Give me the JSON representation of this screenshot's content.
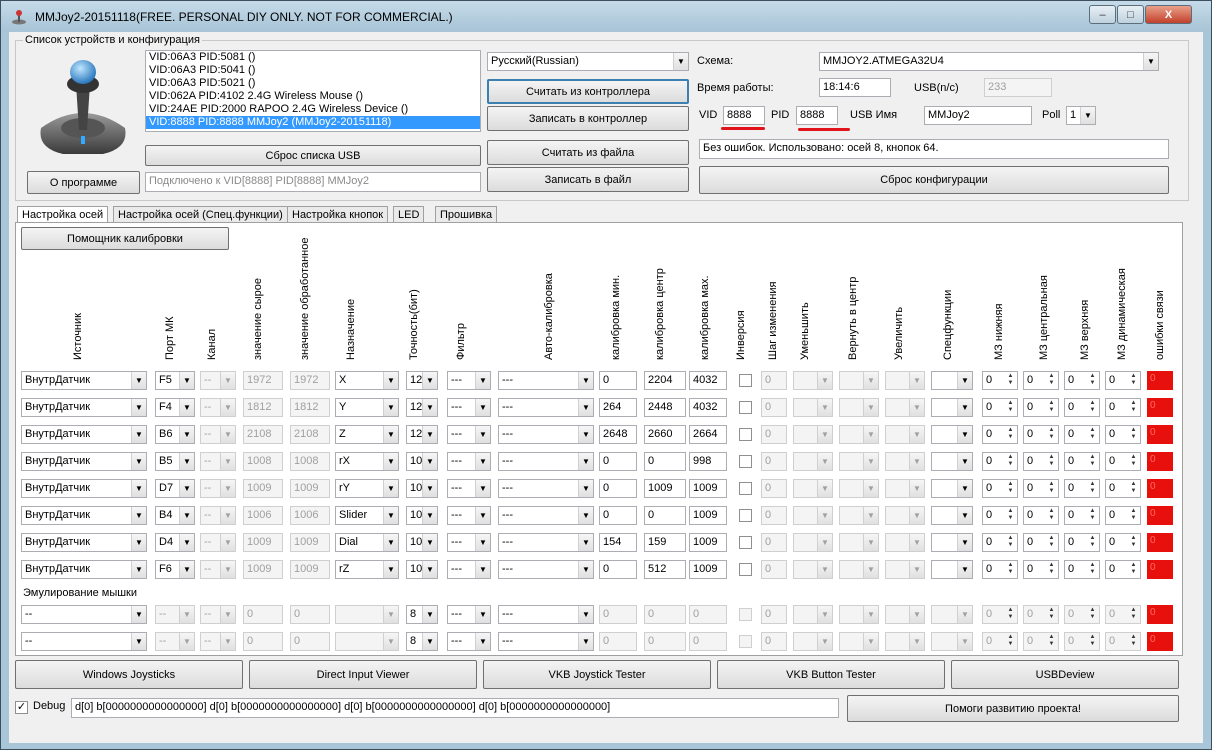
{
  "window": {
    "title": "MMJoy2-20151118(FREE. PERSONAL DIY ONLY. NOT FOR COMMERCIAL.)",
    "min": "–",
    "max": "□",
    "close": "X"
  },
  "devices": {
    "group_label": "Список устройств и конфигурация",
    "list": [
      "VID:06A3 PID:5081  ()",
      "VID:06A3 PID:5041  ()",
      "VID:06A3 PID:5021  ()",
      "VID:062A PID:4102 2.4G Wireless Mouse ()",
      "VID:24AE PID:2000 RAPOO 2.4G Wireless Device ()",
      "VID:8888 PID:8888 MMJoy2 (MMJoy2-20151118)"
    ],
    "reset_usb": "Сброс списка USB",
    "about": "О программе",
    "connected": "Подключено к VID[8888] PID[8888] MMJoy2"
  },
  "controller": {
    "language": "Русский(Russian)",
    "read_controller": "Считать из контроллера",
    "write_controller": "Записать в контроллер",
    "read_file": "Считать из файла",
    "write_file": "Записать в файл"
  },
  "config": {
    "scheme_label": "Схема:",
    "scheme_value": "MMJOY2.ATMEGA32U4",
    "uptime_label": "Время работы:",
    "uptime_value": "18:14:6",
    "usb_nc_label": "USB(n/c)",
    "usb_nc_value": "233",
    "vid_label": "VID",
    "vid_value": "8888",
    "pid_label": "PID",
    "pid_value": "8888",
    "usbname_label": "USB Имя",
    "usbname_value": "MMJoy2",
    "poll_label": "Poll",
    "poll_value": "1",
    "status": "Без ошибок. Использовано: осей  8, кнопок  64.",
    "reset_config": "Сброс конфигурации"
  },
  "tabs": [
    "Настройка осей",
    "Настройка осей (Спец.функции)",
    "Настройка кнопок",
    "LED",
    "Прошивка"
  ],
  "calib_helper": "Помощник калибровки",
  "columns": [
    "Источник",
    "Порт МК",
    "Канал",
    "значение сырое",
    "значение обработанное",
    "Назначение",
    "Точность(бит)",
    "Фильтр",
    "Авто-калибровка",
    "калибровка мин.",
    "калибровка центр",
    "калибровка мах.",
    "Инверсия",
    "Шаг изменения",
    "Уменьшить",
    "Вернуть в центр",
    "Увеличить",
    "Спецфункции",
    "МЗ нижняя",
    "МЗ центральная",
    "МЗ верхняя",
    "МЗ динамическая",
    "ошибки связи"
  ],
  "axes": [
    {
      "src": "ВнутрДатчик",
      "port": "F5",
      "ch": "--",
      "raw": "1972",
      "proc": "1972",
      "dest": "X",
      "bits": "12",
      "filter": "---",
      "auto": "---",
      "min": "0",
      "center": "2204",
      "max": "4032",
      "step": "0",
      "dz1": "0",
      "dz2": "0",
      "dz3": "0",
      "dz4": "0",
      "err": "0"
    },
    {
      "src": "ВнутрДатчик",
      "port": "F4",
      "ch": "--",
      "raw": "1812",
      "proc": "1812",
      "dest": "Y",
      "bits": "12",
      "filter": "---",
      "auto": "---",
      "min": "264",
      "center": "2448",
      "max": "4032",
      "step": "0",
      "dz1": "0",
      "dz2": "0",
      "dz3": "0",
      "dz4": "0",
      "err": "0"
    },
    {
      "src": "ВнутрДатчик",
      "port": "B6",
      "ch": "--",
      "raw": "2108",
      "proc": "2108",
      "dest": "Z",
      "bits": "12",
      "filter": "---",
      "auto": "---",
      "min": "2648",
      "center": "2660",
      "max": "2664",
      "step": "0",
      "dz1": "0",
      "dz2": "0",
      "dz3": "0",
      "dz4": "0",
      "err": "0"
    },
    {
      "src": "ВнутрДатчик",
      "port": "B5",
      "ch": "--",
      "raw": "1008",
      "proc": "1008",
      "dest": "rX",
      "bits": "10",
      "filter": "---",
      "auto": "---",
      "min": "0",
      "center": "0",
      "max": "998",
      "step": "0",
      "dz1": "0",
      "dz2": "0",
      "dz3": "0",
      "dz4": "0",
      "err": "0"
    },
    {
      "src": "ВнутрДатчик",
      "port": "D7",
      "ch": "--",
      "raw": "1009",
      "proc": "1009",
      "dest": "rY",
      "bits": "10",
      "filter": "---",
      "auto": "---",
      "min": "0",
      "center": "1009",
      "max": "1009",
      "step": "0",
      "dz1": "0",
      "dz2": "0",
      "dz3": "0",
      "dz4": "0",
      "err": "0"
    },
    {
      "src": "ВнутрДатчик",
      "port": "B4",
      "ch": "--",
      "raw": "1006",
      "proc": "1006",
      "dest": "Slider",
      "bits": "10",
      "filter": "---",
      "auto": "---",
      "min": "0",
      "center": "0",
      "max": "1009",
      "step": "0",
      "dz1": "0",
      "dz2": "0",
      "dz3": "0",
      "dz4": "0",
      "err": "0"
    },
    {
      "src": "ВнутрДатчик",
      "port": "D4",
      "ch": "--",
      "raw": "1009",
      "proc": "1009",
      "dest": "Dial",
      "bits": "10",
      "filter": "---",
      "auto": "---",
      "min": "154",
      "center": "159",
      "max": "1009",
      "step": "0",
      "dz1": "0",
      "dz2": "0",
      "dz3": "0",
      "dz4": "0",
      "err": "0"
    },
    {
      "src": "ВнутрДатчик",
      "port": "F6",
      "ch": "--",
      "raw": "1009",
      "proc": "1009",
      "dest": "rZ",
      "bits": "10",
      "filter": "---",
      "auto": "---",
      "min": "0",
      "center": "512",
      "max": "1009",
      "step": "0",
      "dz1": "0",
      "dz2": "0",
      "dz3": "0",
      "dz4": "0",
      "err": "0"
    }
  ],
  "mouse_label": "Эмулирование мышки",
  "mouse_rows": [
    {
      "src": "--",
      "port": "--",
      "ch": "--",
      "raw": "0",
      "proc": "0",
      "dest": "",
      "bits": "8",
      "filter": "---",
      "auto": "---",
      "min": "0",
      "center": "0",
      "max": "0",
      "step": "0",
      "dz1": "0",
      "dz2": "0",
      "dz3": "0",
      "dz4": "0",
      "err": "0"
    },
    {
      "src": "--",
      "port": "--",
      "ch": "--",
      "raw": "0",
      "proc": "0",
      "dest": "",
      "bits": "8",
      "filter": "---",
      "auto": "---",
      "min": "0",
      "center": "0",
      "max": "0",
      "step": "0",
      "dz1": "0",
      "dz2": "0",
      "dz3": "0",
      "dz4": "0",
      "err": "0"
    }
  ],
  "tools": [
    "Windows Joysticks",
    "Direct Input Viewer",
    "VKB Joystick Tester",
    "VKB Button Tester",
    "USBDeview"
  ],
  "debug": {
    "label": "Debug",
    "checked": "✓",
    "value": "d[0] b[0000000000000000]   d[0] b[0000000000000000]   d[0] b[0000000000000000]   d[0] b[0000000000000000]"
  },
  "help_project": "Помоги развитию проекта!",
  "colors": {
    "selection": "#3399ff",
    "error_box": "#e8100c",
    "annotation": "#e0141a"
  }
}
